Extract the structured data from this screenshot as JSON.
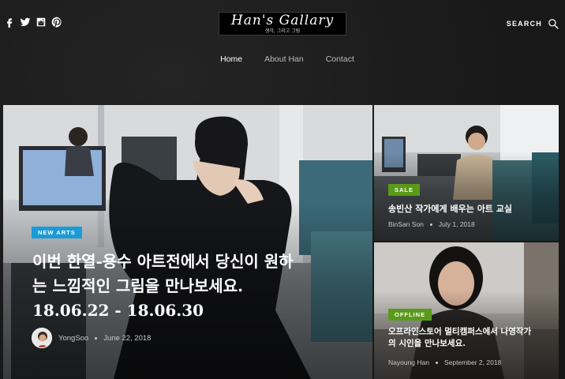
{
  "header": {
    "social": [
      {
        "name": "facebook-icon"
      },
      {
        "name": "twitter-icon"
      },
      {
        "name": "instagram-icon"
      },
      {
        "name": "pinterest-icon"
      }
    ],
    "logo": {
      "title": "Han's Gallary",
      "subtitle": "생각, 그리고 그림"
    },
    "search_label": "SEARCH"
  },
  "nav": {
    "items": [
      {
        "label": "Home",
        "active": true
      },
      {
        "label": "About Han",
        "active": false
      },
      {
        "label": "Contact",
        "active": false
      }
    ]
  },
  "featured": {
    "main": {
      "badge": "NEW ARTS",
      "title_line1": "이번 한열-용수 아트전에서 당신이 원하",
      "title_line2": "는 느낌적인 그림을 만나보세요.",
      "title_line3": "18.06.22 - 18.06.30",
      "author": "YongSoo",
      "date": "June 22, 2018"
    },
    "top": {
      "badge": "SALE",
      "title": "송빈산 작가에게 배우는 아트 교실",
      "author": "BinSan Son",
      "date": "July 1, 2018"
    },
    "bottom": {
      "badge": "OFFLINE",
      "title_line1": "오프라인스토어 멀티캠퍼스에서 나영작가",
      "title_line2": "의 시인을 만나보세요.",
      "author": "Nayoung Han",
      "date": "September 2, 2018"
    }
  },
  "colors": {
    "background": "#1b1b1b",
    "badge_blue": "#1a9bd7",
    "badge_green": "#5a9a1a"
  }
}
